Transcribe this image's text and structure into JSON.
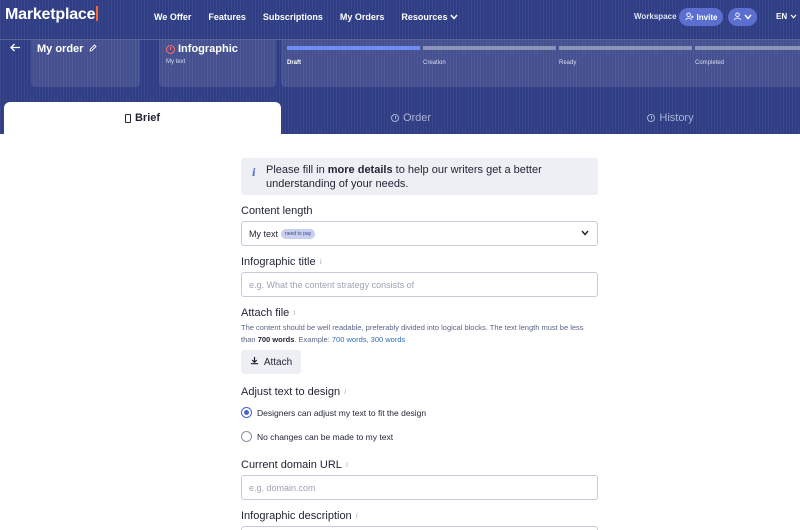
{
  "nav": {
    "logo": "Marketplace",
    "links": [
      "We Offer",
      "Features",
      "Subscriptions",
      "My Orders",
      "Resources"
    ],
    "workspace": "Workspace",
    "invite": "Invite",
    "lang": "EN"
  },
  "order": {
    "title": "My order"
  },
  "product": {
    "title": "Infographic",
    "subtitle": "My text"
  },
  "progress": {
    "steps": [
      "Draft",
      "Creation",
      "Ready",
      "Completed"
    ],
    "active_index": 0
  },
  "tabs": [
    {
      "label": "Brief"
    },
    {
      "label": "Order"
    },
    {
      "label": "History"
    }
  ],
  "form": {
    "notice_pre": "Please fill in ",
    "notice_bold": "more details",
    "notice_post": " to help our writers get a better understanding of your needs.",
    "content_length": {
      "label": "Content length",
      "value": "My text",
      "tag": "need to pay"
    },
    "title": {
      "label": "Infographic title",
      "placeholder": "e.g. What the content strategy consists of"
    },
    "attach": {
      "label": "Attach file",
      "hint_pre": "The content should be well readable, preferably divided into logical blocks. The text length must be less than ",
      "hint_bold": "700 words",
      "hint_mid": ". Example: ",
      "hint_link1": "700 words",
      "hint_sep": ", ",
      "hint_link2": "300 words",
      "button": "Attach"
    },
    "adjust": {
      "label": "Adjust text to design",
      "options": [
        "Designers can adjust my text to fit the design",
        "No changes can be made to my text"
      ],
      "selected": 0
    },
    "domain": {
      "label": "Current domain URL",
      "placeholder": "e.g. domain.com"
    },
    "description": {
      "label": "Infographic description"
    }
  },
  "colors": {
    "header": "#2f3d84",
    "accent": "#5b6fd1",
    "progress_active": "#6e8ef5",
    "logo_bar": "#ff642d"
  }
}
